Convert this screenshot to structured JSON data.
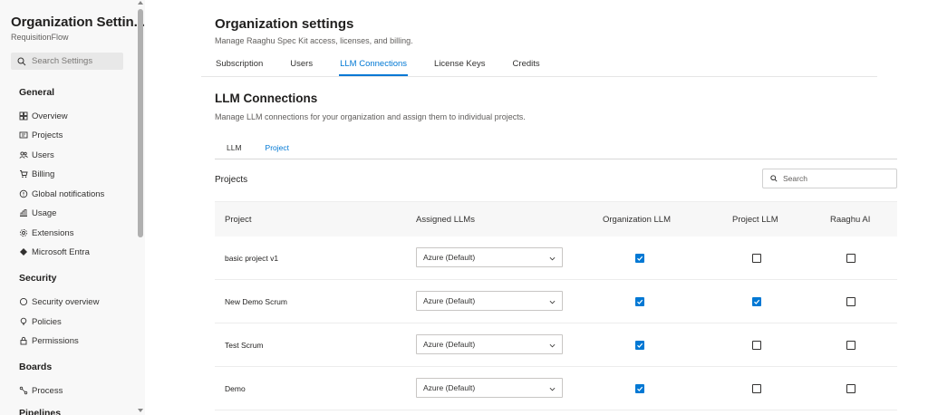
{
  "sidebar": {
    "title": "Organization Settin...",
    "subtitle": "RequisitionFlow",
    "search_placeholder": "Search Settings",
    "sections": {
      "general": "General",
      "security": "Security",
      "boards": "Boards",
      "pipelines_partial": "Pipelines"
    },
    "items": {
      "overview": "Overview",
      "projects": "Projects",
      "users": "Users",
      "billing": "Billing",
      "global_notifications": "Global notifications",
      "usage": "Usage",
      "extensions": "Extensions",
      "microsoft_entra": "Microsoft Entra",
      "security_overview": "Security overview",
      "policies": "Policies",
      "permissions": "Permissions",
      "process": "Process"
    }
  },
  "header": {
    "title": "Organization settings",
    "description": "Manage Raaghu Spec Kit access, licenses, and billing.",
    "tabs": [
      "Subscription",
      "Users",
      "LLM Connections",
      "License Keys",
      "Credits"
    ],
    "active_tab": "LLM Connections"
  },
  "section": {
    "title": "LLM Connections",
    "description": "Manage LLM connections for your organization and assign them to individual projects.",
    "subtabs": [
      "LLM",
      "Project"
    ],
    "active_subtab": "Project"
  },
  "projects": {
    "label": "Projects",
    "search_placeholder": "Search",
    "columns": [
      "Project",
      "Assigned LLMs",
      "Organization LLM",
      "Project LLM",
      "Raaghu AI"
    ],
    "rows": [
      {
        "name": "basic project v1",
        "assigned": "Azure (Default)",
        "org_llm": true,
        "project_llm": false,
        "raaghu_ai": false
      },
      {
        "name": "New Demo Scrum",
        "assigned": "Azure (Default)",
        "org_llm": true,
        "project_llm": true,
        "raaghu_ai": false
      },
      {
        "name": "Test Scrum",
        "assigned": "Azure (Default)",
        "org_llm": true,
        "project_llm": false,
        "raaghu_ai": false
      },
      {
        "name": "Demo",
        "assigned": "Azure (Default)",
        "org_llm": true,
        "project_llm": false,
        "raaghu_ai": false
      }
    ]
  },
  "colors": {
    "accent": "#0078d4",
    "text": "#201f1e",
    "muted": "#605e5c"
  }
}
